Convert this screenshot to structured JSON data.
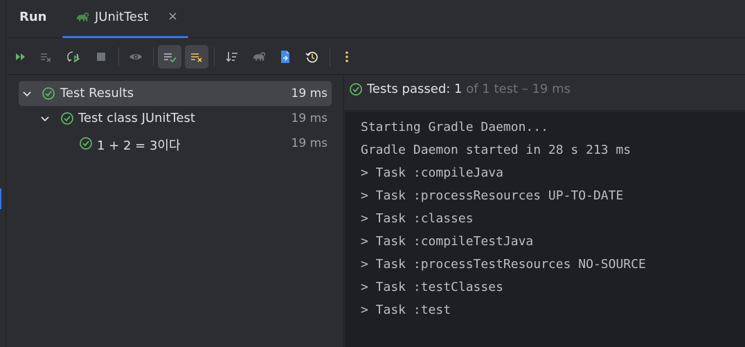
{
  "header": {
    "title": "Run",
    "tab": {
      "label": "JUnitTest",
      "close": "×",
      "icon": "gradle-elephant-icon"
    }
  },
  "toolbar": {
    "buttons": [
      {
        "name": "rerun-icon",
        "active": false
      },
      {
        "name": "rerun-failed-icon",
        "active": false
      },
      {
        "name": "toggle-auto-test-icon",
        "active": false
      },
      {
        "name": "stop-icon",
        "active": false
      },
      {
        "name": "show-ignored-icon",
        "active": false
      },
      {
        "name": "show-passed-icon",
        "active": true
      },
      {
        "name": "show-failed-icon",
        "active": true
      },
      {
        "name": "sort-icon",
        "active": false
      },
      {
        "name": "gradle-icon",
        "active": false
      },
      {
        "name": "export-icon",
        "active": false
      },
      {
        "name": "history-icon",
        "active": false
      },
      {
        "name": "more-icon",
        "active": false
      }
    ]
  },
  "tree": {
    "rows": [
      {
        "label": "Test Results",
        "time": "19 ms"
      },
      {
        "label": "Test class JUnitTest",
        "time": "19 ms"
      },
      {
        "label": "1 + 2 = 3이다",
        "time": "19 ms"
      }
    ]
  },
  "status": {
    "passed_label": "Tests passed: 1",
    "detail": " of 1 test – 19 ms"
  },
  "console": {
    "lines": [
      "Starting Gradle Daemon...",
      "Gradle Daemon started in 28 s 213 ms",
      "> Task :compileJava",
      "> Task :processResources UP-TO-DATE",
      "> Task :classes",
      "> Task :compileTestJava",
      "> Task :processTestResources NO-SOURCE",
      "> Task :testClasses",
      "> Task :test"
    ]
  },
  "colors": {
    "accent": "#3574f0",
    "success": "#5fb865",
    "warning": "#f2c55c",
    "rerun": "#5fb865"
  }
}
